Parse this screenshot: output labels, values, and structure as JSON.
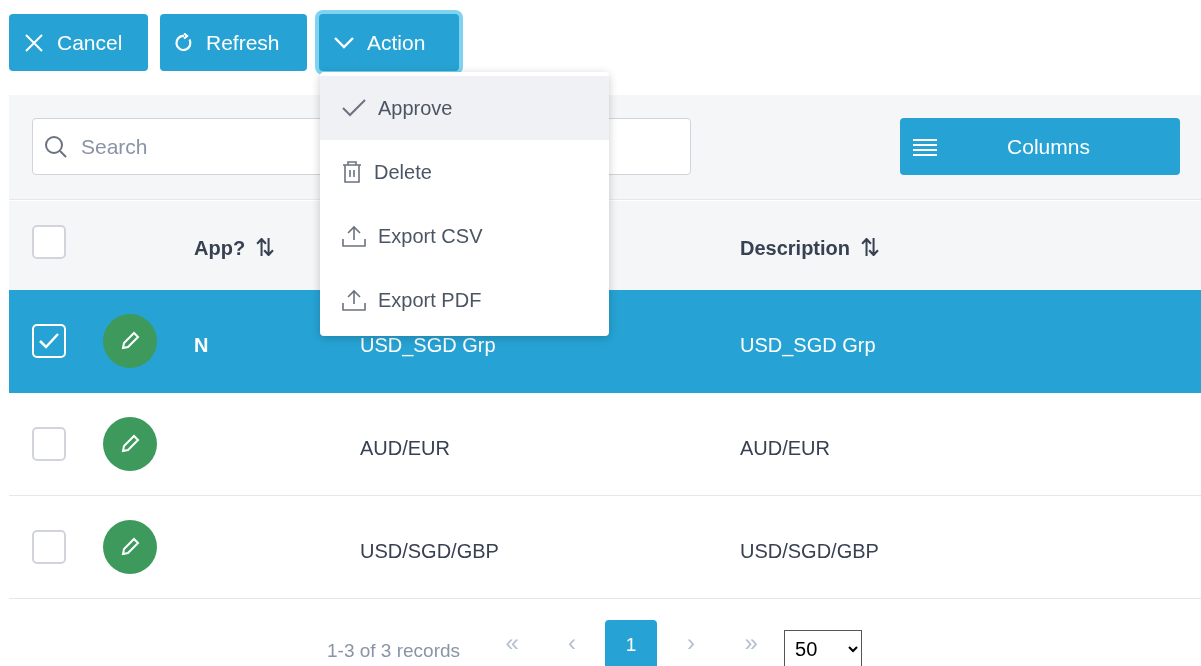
{
  "toolbar": {
    "buttons": [
      {
        "label": "Cancel",
        "kind": "cancel",
        "focused": false
      },
      {
        "label": "Refresh",
        "kind": "refresh",
        "focused": false
      },
      {
        "label": "Action",
        "kind": "action",
        "focused": true
      }
    ]
  },
  "action_menu": {
    "items": [
      {
        "label": "Approve",
        "kind": "approve",
        "highlighted": true
      },
      {
        "label": "Delete",
        "kind": "delete",
        "highlighted": false
      },
      {
        "label": "Export CSV",
        "kind": "export",
        "highlighted": false
      },
      {
        "label": "Export PDF",
        "kind": "export",
        "highlighted": false
      }
    ]
  },
  "search": {
    "placeholder": "Search"
  },
  "columns_button": {
    "label": "Columns"
  },
  "table": {
    "select_all_checked": false,
    "columns": [
      {
        "label": "App?",
        "sort_icon": "⇅"
      },
      {
        "label": "Description",
        "sort_icon": "⇅"
      }
    ],
    "rows": [
      {
        "selected": true,
        "checked": true,
        "app": "N",
        "column_4": "USD_SGD Grp",
        "description": "USD_SGD Grp"
      },
      {
        "selected": false,
        "checked": false,
        "app": "",
        "column_4": "AUD/EUR",
        "description": "AUD/EUR"
      },
      {
        "selected": false,
        "checked": false,
        "app": "",
        "column_4": "USD/SGD/GBP",
        "description": "USD/SGD/GBP"
      }
    ]
  },
  "pagination": {
    "summary": "1-3 of 3 records",
    "first": "«",
    "prev": "‹",
    "pages": [
      {
        "label": "1",
        "selected": true
      }
    ],
    "next": "›",
    "last": "»",
    "page_size": "50"
  }
}
